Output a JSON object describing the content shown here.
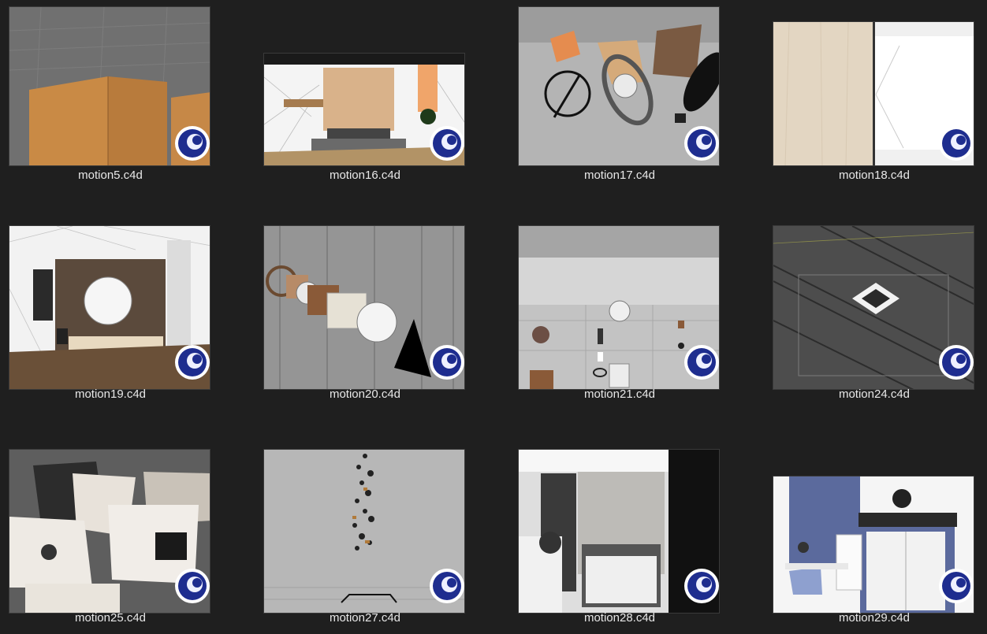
{
  "files": [
    {
      "name": "motion5.c4d"
    },
    {
      "name": "motion16.c4d"
    },
    {
      "name": "motion17.c4d"
    },
    {
      "name": "motion18.c4d"
    },
    {
      "name": "motion19.c4d"
    },
    {
      "name": "motion20.c4d"
    },
    {
      "name": "motion21.c4d"
    },
    {
      "name": "motion24.c4d"
    },
    {
      "name": "motion25.c4d"
    },
    {
      "name": "motion27.c4d"
    },
    {
      "name": "motion28.c4d"
    },
    {
      "name": "motion29.c4d"
    }
  ],
  "file_type_icon": "cinema4d-icon",
  "colors": {
    "background": "#1f1f1f",
    "label_text": "#e8e8e8",
    "c4d_badge_blue": "#1e2d8f"
  }
}
